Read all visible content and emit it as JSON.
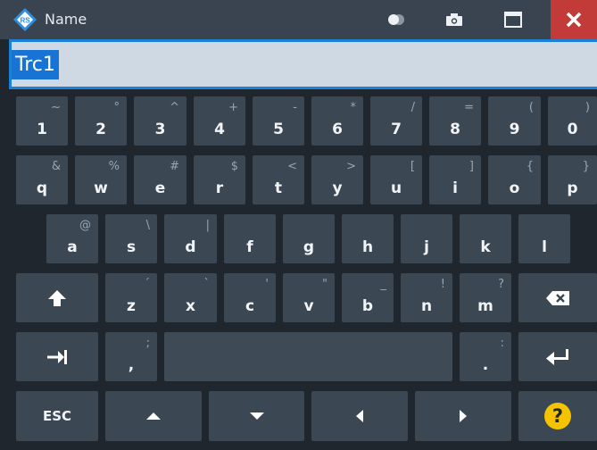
{
  "window": {
    "title": "Name",
    "icons": {
      "logo": "rohde-schwarz-logo-icon",
      "toggle": "toggle-icon",
      "camera": "camera-icon",
      "maximize": "maximize-icon",
      "close": "close-icon"
    }
  },
  "input": {
    "value": "Trc1"
  },
  "colors": {
    "titlebar": "#3a4450",
    "close": "#c23b38",
    "accent": "#1a80d8",
    "key": "#3c4754",
    "help": "#f5c400"
  },
  "keys": {
    "row1": [
      {
        "main": "1",
        "sub": "~"
      },
      {
        "main": "2",
        "sub": "°"
      },
      {
        "main": "3",
        "sub": "^"
      },
      {
        "main": "4",
        "sub": "+"
      },
      {
        "main": "5",
        "sub": "-"
      },
      {
        "main": "6",
        "sub": "*"
      },
      {
        "main": "7",
        "sub": "/"
      },
      {
        "main": "8",
        "sub": "="
      },
      {
        "main": "9",
        "sub": "("
      },
      {
        "main": "0",
        "sub": ")"
      }
    ],
    "row2": [
      {
        "main": "q",
        "sub": "&"
      },
      {
        "main": "w",
        "sub": "%"
      },
      {
        "main": "e",
        "sub": "#"
      },
      {
        "main": "r",
        "sub": "$"
      },
      {
        "main": "t",
        "sub": "<"
      },
      {
        "main": "y",
        "sub": ">"
      },
      {
        "main": "u",
        "sub": "["
      },
      {
        "main": "i",
        "sub": "]"
      },
      {
        "main": "o",
        "sub": "{"
      },
      {
        "main": "p",
        "sub": "}"
      }
    ],
    "row3": [
      {
        "main": "a",
        "sub": "@"
      },
      {
        "main": "s",
        "sub": "\\"
      },
      {
        "main": "d",
        "sub": "|"
      },
      {
        "main": "f",
        "sub": ""
      },
      {
        "main": "g",
        "sub": ""
      },
      {
        "main": "h",
        "sub": ""
      },
      {
        "main": "j",
        "sub": ""
      },
      {
        "main": "k",
        "sub": ""
      },
      {
        "main": "l",
        "sub": ""
      }
    ],
    "row4": [
      {
        "main": "z",
        "sub": "´"
      },
      {
        "main": "x",
        "sub": "`"
      },
      {
        "main": "c",
        "sub": "'"
      },
      {
        "main": "v",
        "sub": "\""
      },
      {
        "main": "b",
        "sub": "_"
      },
      {
        "main": "n",
        "sub": "!"
      },
      {
        "main": "m",
        "sub": "?"
      }
    ],
    "row5": [
      {
        "main": ",",
        "sub": ";"
      },
      {
        "main": ".",
        "sub": ":"
      }
    ],
    "esc_label": "ESC",
    "icon_names": {
      "shift": "shift-up-arrow-icon",
      "backspace": "backspace-icon",
      "tab": "tab-icon",
      "enter": "enter-icon",
      "up": "arrow-up-icon",
      "down": "arrow-down-icon",
      "left": "arrow-left-icon",
      "right": "arrow-right-icon",
      "help": "help-icon"
    }
  }
}
